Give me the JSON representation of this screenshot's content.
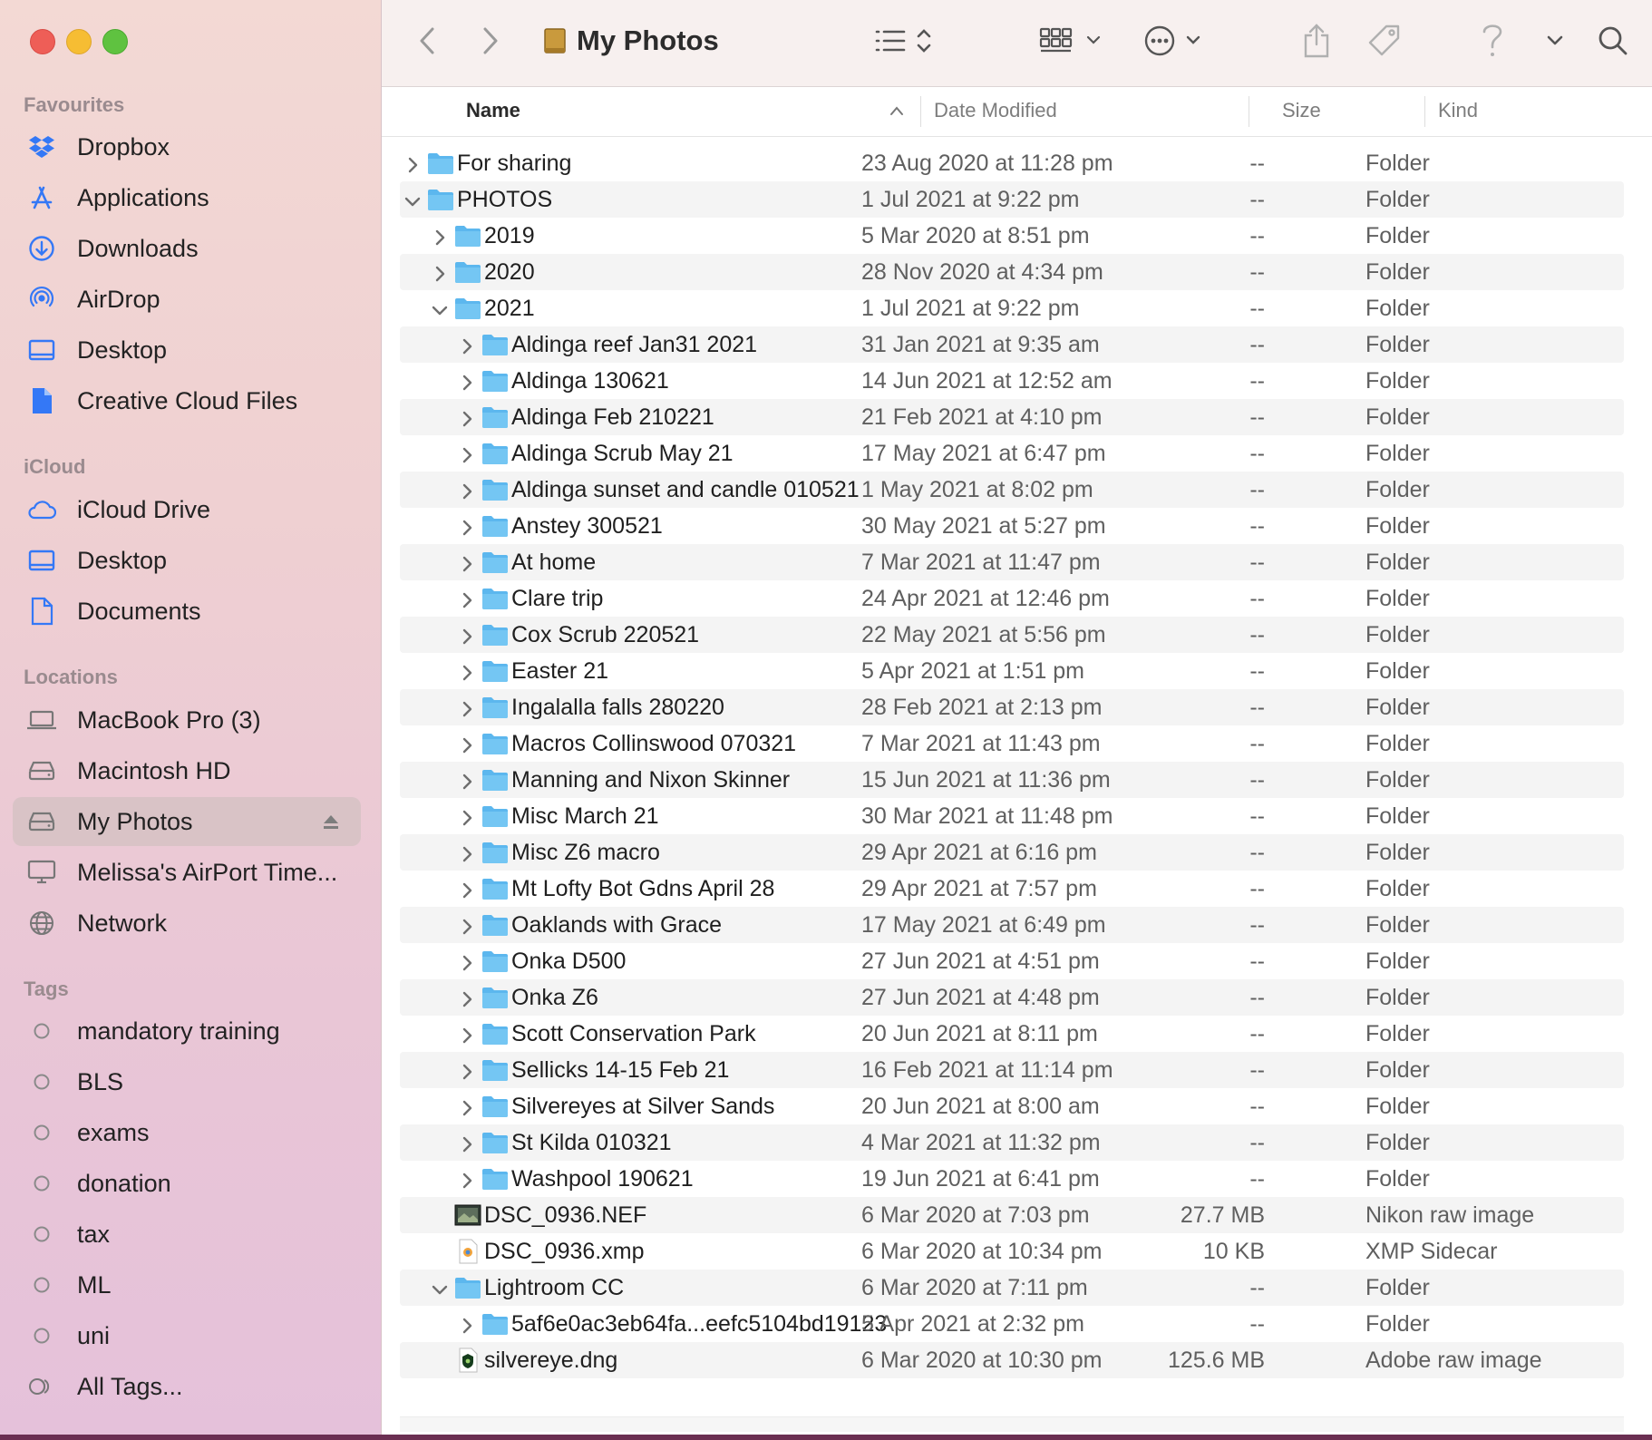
{
  "window_title": "My Photos",
  "sidebar": {
    "favourites_label": "Favourites",
    "favourites": [
      {
        "label": "Dropbox",
        "icon": "dropbox-icon"
      },
      {
        "label": "Applications",
        "icon": "applications-icon"
      },
      {
        "label": "Downloads",
        "icon": "downloads-icon"
      },
      {
        "label": "AirDrop",
        "icon": "airdrop-icon"
      },
      {
        "label": "Desktop",
        "icon": "desktop-icon"
      },
      {
        "label": "Creative Cloud Files",
        "icon": "document-icon"
      }
    ],
    "icloud_label": "iCloud",
    "icloud": [
      {
        "label": "iCloud Drive",
        "icon": "cloud-icon"
      },
      {
        "label": "Desktop",
        "icon": "desktop-icon"
      },
      {
        "label": "Documents",
        "icon": "document-outline-icon"
      }
    ],
    "locations_label": "Locations",
    "locations": [
      {
        "label": "MacBook Pro (3)",
        "icon": "laptop-icon"
      },
      {
        "label": "Macintosh HD",
        "icon": "drive-icon"
      },
      {
        "label": "My Photos",
        "icon": "drive-icon",
        "selected": true
      },
      {
        "label": "Melissa's AirPort Time...",
        "icon": "monitor-icon"
      },
      {
        "label": "Network",
        "icon": "globe-icon"
      }
    ],
    "tags_label": "Tags",
    "tags": [
      {
        "label": "mandatory training"
      },
      {
        "label": "BLS"
      },
      {
        "label": "exams"
      },
      {
        "label": "donation"
      },
      {
        "label": "tax"
      },
      {
        "label": "ML"
      },
      {
        "label": "uni"
      },
      {
        "label": "All Tags..."
      }
    ]
  },
  "columns": {
    "name": "Name",
    "date": "Date Modified",
    "size": "Size",
    "kind": "Kind"
  },
  "rows": [
    {
      "name": "For sharing",
      "date": "23 Aug 2020 at 11:28 pm",
      "size": "--",
      "kind": "Folder",
      "level": 0,
      "disclosure": "collapsed",
      "type": "folder"
    },
    {
      "name": "PHOTOS",
      "date": "1 Jul 2021 at 9:22 pm",
      "size": "--",
      "kind": "Folder",
      "level": 0,
      "disclosure": "expanded",
      "type": "folder"
    },
    {
      "name": "2019",
      "date": "5 Mar 2020 at 8:51 pm",
      "size": "--",
      "kind": "Folder",
      "level": 1,
      "disclosure": "collapsed",
      "type": "folder"
    },
    {
      "name": "2020",
      "date": "28 Nov 2020 at 4:34 pm",
      "size": "--",
      "kind": "Folder",
      "level": 1,
      "disclosure": "collapsed",
      "type": "folder"
    },
    {
      "name": "2021",
      "date": "1 Jul 2021 at 9:22 pm",
      "size": "--",
      "kind": "Folder",
      "level": 1,
      "disclosure": "expanded",
      "type": "folder"
    },
    {
      "name": "Aldinga  reef Jan31 2021",
      "date": "31 Jan 2021 at 9:35 am",
      "size": "--",
      "kind": "Folder",
      "level": 2,
      "disclosure": "collapsed",
      "type": "folder"
    },
    {
      "name": "Aldinga 130621",
      "date": "14 Jun 2021 at 12:52 am",
      "size": "--",
      "kind": "Folder",
      "level": 2,
      "disclosure": "collapsed",
      "type": "folder"
    },
    {
      "name": "Aldinga Feb 210221",
      "date": "21 Feb 2021 at 4:10 pm",
      "size": "--",
      "kind": "Folder",
      "level": 2,
      "disclosure": "collapsed",
      "type": "folder"
    },
    {
      "name": "Aldinga Scrub  May  21",
      "date": "17 May 2021 at 6:47 pm",
      "size": "--",
      "kind": "Folder",
      "level": 2,
      "disclosure": "collapsed",
      "type": "folder"
    },
    {
      "name": "Aldinga sunset and candle 010521",
      "date": "1 May 2021 at 8:02 pm",
      "size": "--",
      "kind": "Folder",
      "level": 2,
      "disclosure": "collapsed",
      "type": "folder"
    },
    {
      "name": "Anstey 300521",
      "date": "30 May 2021 at 5:27 pm",
      "size": "--",
      "kind": "Folder",
      "level": 2,
      "disclosure": "collapsed",
      "type": "folder"
    },
    {
      "name": "At home",
      "date": "7 Mar 2021 at 11:47 pm",
      "size": "--",
      "kind": "Folder",
      "level": 2,
      "disclosure": "collapsed",
      "type": "folder"
    },
    {
      "name": "Clare  trip",
      "date": "24 Apr 2021 at 12:46 pm",
      "size": "--",
      "kind": "Folder",
      "level": 2,
      "disclosure": "collapsed",
      "type": "folder"
    },
    {
      "name": "Cox Scrub  220521",
      "date": "22 May 2021 at 5:56 pm",
      "size": "--",
      "kind": "Folder",
      "level": 2,
      "disclosure": "collapsed",
      "type": "folder"
    },
    {
      "name": "Easter 21",
      "date": "5 Apr 2021 at 1:51 pm",
      "size": "--",
      "kind": "Folder",
      "level": 2,
      "disclosure": "collapsed",
      "type": "folder"
    },
    {
      "name": "Ingalalla falls 280220",
      "date": "28 Feb 2021 at 2:13 pm",
      "size": "--",
      "kind": "Folder",
      "level": 2,
      "disclosure": "collapsed",
      "type": "folder"
    },
    {
      "name": "Macros Collinswood 070321",
      "date": "7 Mar 2021 at 11:43 pm",
      "size": "--",
      "kind": "Folder",
      "level": 2,
      "disclosure": "collapsed",
      "type": "folder"
    },
    {
      "name": "Manning and Nixon Skinner",
      "date": "15 Jun 2021 at 11:36 pm",
      "size": "--",
      "kind": "Folder",
      "level": 2,
      "disclosure": "collapsed",
      "type": "folder"
    },
    {
      "name": "Misc March 21",
      "date": "30 Mar 2021 at 11:48 pm",
      "size": "--",
      "kind": "Folder",
      "level": 2,
      "disclosure": "collapsed",
      "type": "folder"
    },
    {
      "name": "Misc Z6 macro",
      "date": "29 Apr 2021 at 6:16 pm",
      "size": "--",
      "kind": "Folder",
      "level": 2,
      "disclosure": "collapsed",
      "type": "folder"
    },
    {
      "name": "Mt Lofty Bot Gdns April 28",
      "date": "29 Apr 2021 at 7:57 pm",
      "size": "--",
      "kind": "Folder",
      "level": 2,
      "disclosure": "collapsed",
      "type": "folder"
    },
    {
      "name": "Oaklands with Grace",
      "date": "17 May 2021 at 6:49 pm",
      "size": "--",
      "kind": "Folder",
      "level": 2,
      "disclosure": "collapsed",
      "type": "folder"
    },
    {
      "name": "Onka D500",
      "date": "27 Jun 2021 at 4:51 pm",
      "size": "--",
      "kind": "Folder",
      "level": 2,
      "disclosure": "collapsed",
      "type": "folder"
    },
    {
      "name": "Onka Z6",
      "date": "27 Jun 2021 at 4:48 pm",
      "size": "--",
      "kind": "Folder",
      "level": 2,
      "disclosure": "collapsed",
      "type": "folder"
    },
    {
      "name": "Scott  Conservation Park",
      "date": "20 Jun 2021 at 8:11 pm",
      "size": "--",
      "kind": "Folder",
      "level": 2,
      "disclosure": "collapsed",
      "type": "folder"
    },
    {
      "name": "Sellicks  14-15  Feb  21",
      "date": "16 Feb 2021 at 11:14 pm",
      "size": "--",
      "kind": "Folder",
      "level": 2,
      "disclosure": "collapsed",
      "type": "folder"
    },
    {
      "name": "Silvereyes at Silver Sands",
      "date": "20 Jun 2021 at 8:00 am",
      "size": "--",
      "kind": "Folder",
      "level": 2,
      "disclosure": "collapsed",
      "type": "folder"
    },
    {
      "name": "St Kilda 010321",
      "date": "4 Mar 2021 at 11:32 pm",
      "size": "--",
      "kind": "Folder",
      "level": 2,
      "disclosure": "collapsed",
      "type": "folder"
    },
    {
      "name": "Washpool 190621",
      "date": "19 Jun 2021 at 6:41 pm",
      "size": "--",
      "kind": "Folder",
      "level": 2,
      "disclosure": "collapsed",
      "type": "folder"
    },
    {
      "name": "DSC_0936.NEF",
      "date": "6 Mar 2020 at 7:03 pm",
      "size": "27.7 MB",
      "kind": "Nikon raw image",
      "level": 1,
      "disclosure": "none",
      "type": "nef"
    },
    {
      "name": "DSC_0936.xmp",
      "date": "6 Mar 2020 at 10:34 pm",
      "size": "10 KB",
      "kind": "XMP Sidecar",
      "level": 1,
      "disclosure": "none",
      "type": "xmp"
    },
    {
      "name": "Lightroom CC",
      "date": "6 Mar 2020 at 7:11 pm",
      "size": "--",
      "kind": "Folder",
      "level": 1,
      "disclosure": "expanded",
      "type": "folder"
    },
    {
      "name": "5af6e0ac3eb64fa...eefc5104bd19123",
      "date": "5 Apr 2021 at 2:32 pm",
      "size": "--",
      "kind": "Folder",
      "level": 2,
      "disclosure": "collapsed",
      "type": "folder"
    },
    {
      "name": "silvereye.dng",
      "date": "6 Mar 2020 at 10:30 pm",
      "size": "125.6 MB",
      "kind": "Adobe raw image",
      "level": 1,
      "disclosure": "none",
      "type": "dng"
    }
  ],
  "colors": {
    "accent": "#3478f6",
    "folder": "#5cb7ee",
    "selected_sidebar": "#d9c3c6"
  }
}
